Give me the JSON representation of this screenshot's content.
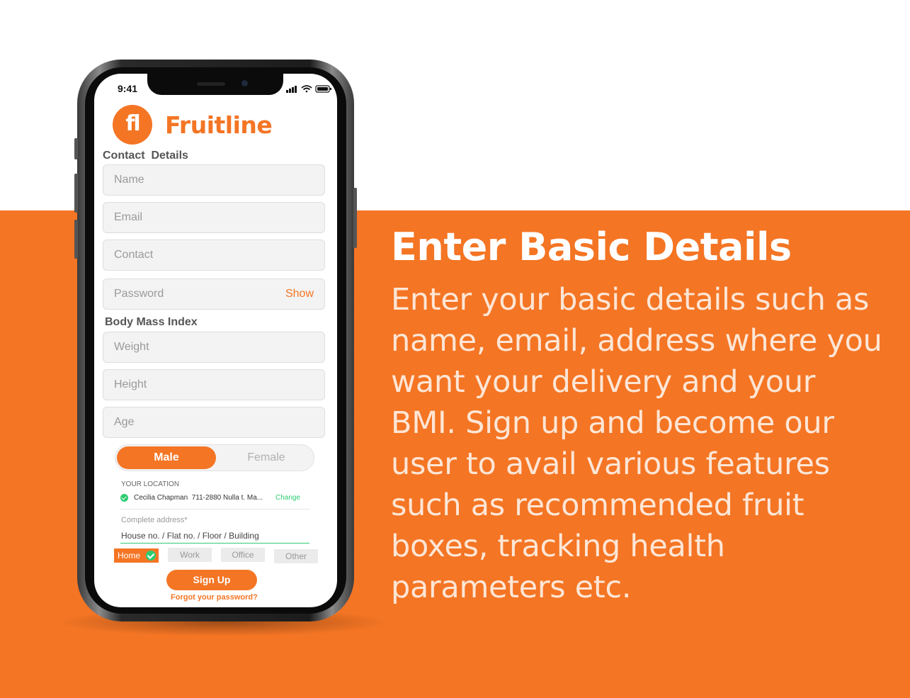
{
  "colors": {
    "brand_orange": "#f47524",
    "success_green": "#2ecc71",
    "white": "#ffffff"
  },
  "promo": {
    "headline": "Enter Basic Details",
    "body": "Enter your basic details such as name, email, address where you want your delivery and your BMI. Sign up and become our user to avail various features such as recommended fruit boxes, tracking health parameters etc."
  },
  "phone": {
    "status_bar": {
      "time": "9:41",
      "icons": [
        "signal-icon",
        "wifi-icon",
        "battery-icon"
      ]
    },
    "app": {
      "logo_text": "fl",
      "brand_name": "Fruitline",
      "contact_section_title": "Contact  Details",
      "fields": {
        "name_placeholder": "Name",
        "email_placeholder": "Email",
        "contact_placeholder": "Contact",
        "password_placeholder": "Password",
        "password_show_label": "Show"
      },
      "bmi_section_title": "Body Mass Index",
      "bmi_fields": {
        "weight_placeholder": "Weight",
        "height_placeholder": "Height",
        "age_placeholder": "Age"
      },
      "gender": {
        "options": [
          "Male",
          "Female"
        ],
        "selected": "Male"
      },
      "location": {
        "title": "YOUR LOCATION",
        "address_summary": "Cecilia Chapman  711-2880 Nulla t. Ma...",
        "change_label": "Change",
        "complete_address_label": "Complete address*",
        "complete_address_value": "House no. / Flat no. / Floor / Building"
      },
      "address_tags": {
        "items": [
          "Home",
          "Work",
          "Office",
          "Other"
        ],
        "selected": "Home"
      },
      "signup_label": "Sign Up",
      "forgot_password_label": "Forgot your password?"
    }
  }
}
